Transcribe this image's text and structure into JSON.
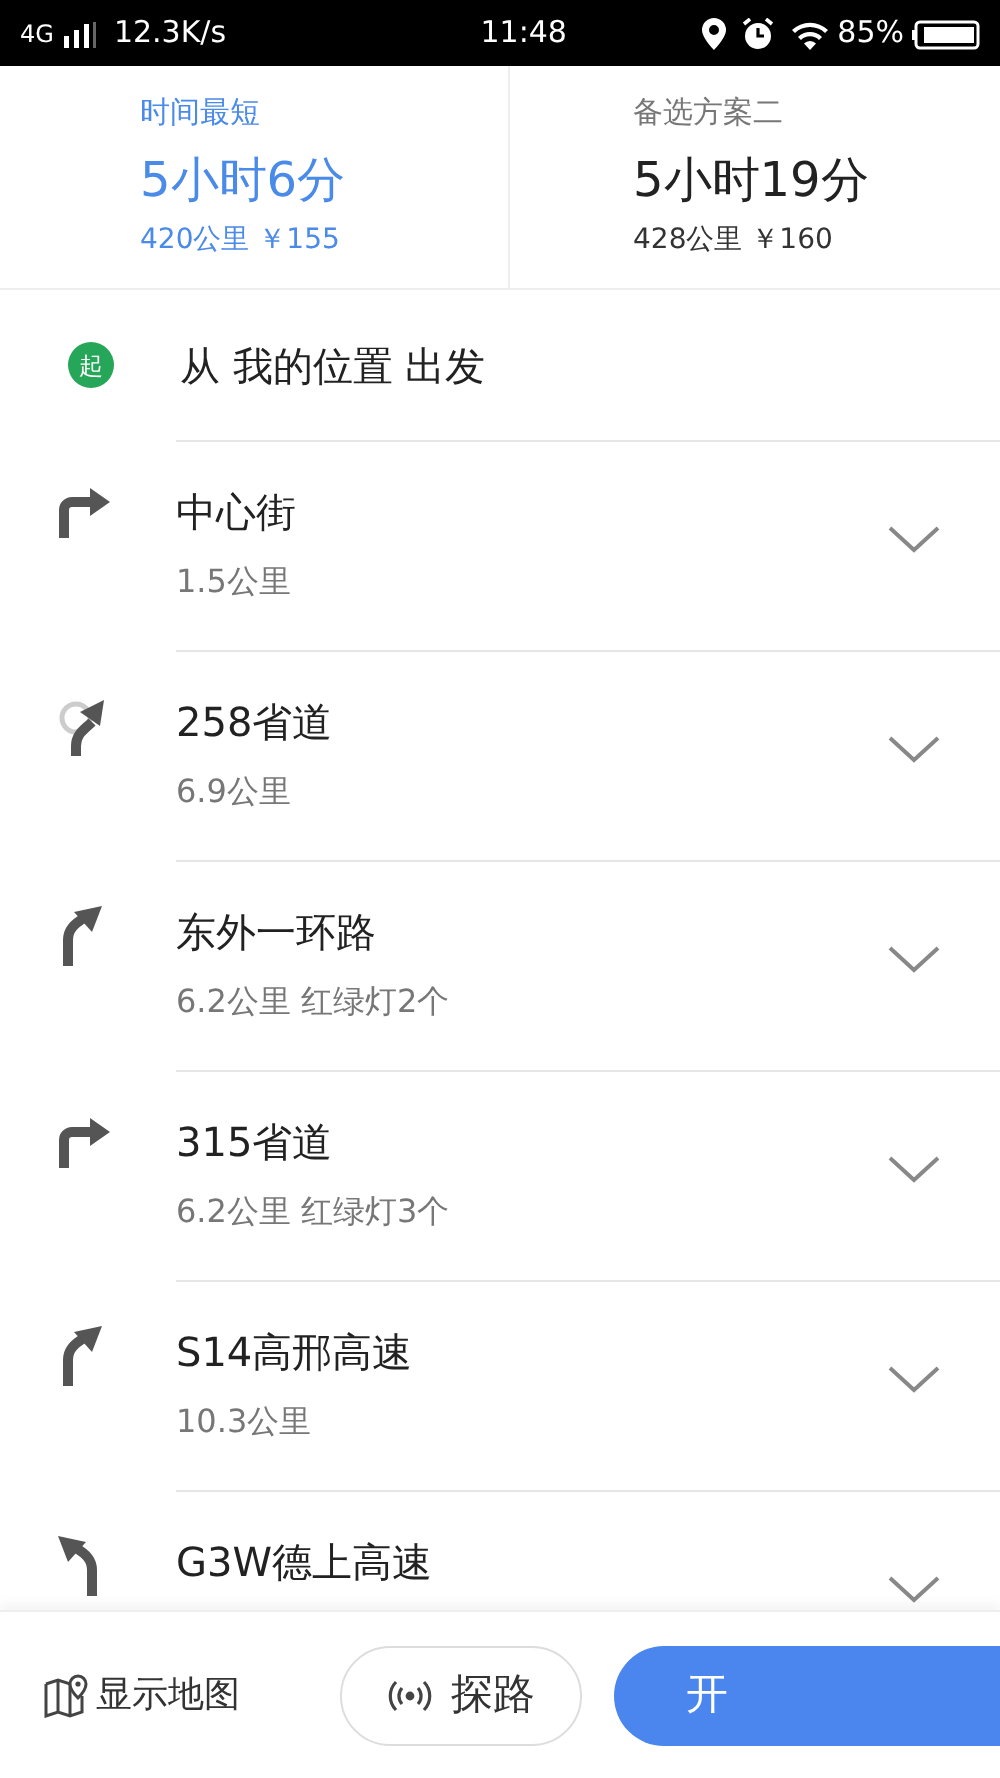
{
  "status_bar": {
    "network": "4G",
    "speed": "12.3K/s",
    "time": "11:48",
    "battery": "85%"
  },
  "routes": [
    {
      "label": "时间最短",
      "duration": "5小时6分",
      "summary": "420公里 ￥155",
      "selected": true
    },
    {
      "label": "备选方案二",
      "duration": "5小时19分",
      "summary": "428公里 ￥160",
      "selected": false
    }
  ],
  "start": {
    "badge": "起",
    "text": "从 我的位置 出发"
  },
  "steps": [
    {
      "kind": "right",
      "road": "中心街",
      "detail": "1.5公里"
    },
    {
      "kind": "roundabout",
      "road": "258省道",
      "detail": "6.9公里"
    },
    {
      "kind": "bear-right",
      "road": "东外一环路",
      "detail": "6.2公里 红绿灯2个"
    },
    {
      "kind": "right",
      "road": "315省道",
      "detail": "6.2公里 红绿灯3个"
    },
    {
      "kind": "bear-right",
      "road": "S14高邢高速",
      "detail": "10.3公里"
    },
    {
      "kind": "bear-left",
      "road": "G3W德上高速"
    }
  ],
  "bottom_bar": {
    "map_label": "显示地图",
    "explore_label": "探路",
    "start_label": "开"
  }
}
